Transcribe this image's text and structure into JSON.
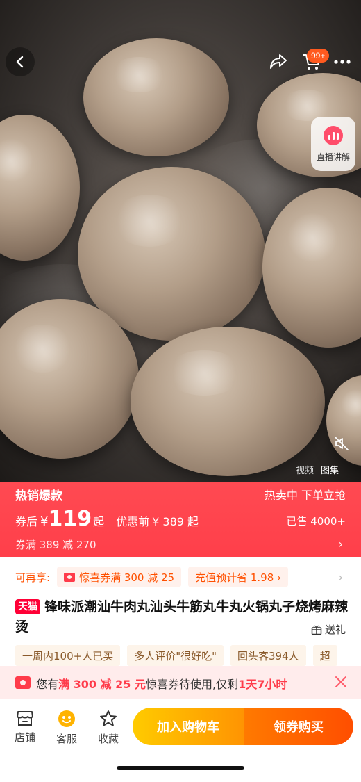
{
  "hero": {
    "cart_badge": "99+",
    "live_label": "直播讲解",
    "media_tabs": [
      "视频",
      "图集"
    ]
  },
  "banner": {
    "hot_label": "热销爆款",
    "selling_label": "热卖中 下单立抢",
    "after_coupon_label": "券后",
    "currency": "¥",
    "price": "119",
    "price_suffix": "起",
    "original_label": "优惠前",
    "original_price": "¥ 389 起",
    "sold": "已售 4000+",
    "coupon_info": "券满 389 减 270"
  },
  "benefits": {
    "label": "可再享:",
    "coupon_chip": "惊喜券满 300 减 25",
    "recharge_chip": "充值预计省 1.98 ›"
  },
  "product": {
    "badge": "天猫",
    "title": "锋味派潮汕牛肉丸汕头牛筋丸牛丸火锅丸子烧烤麻辣烫",
    "gift": "送礼",
    "tags": [
      "一周内100+人已买",
      "多人评价\"很好吃\"",
      "回头客394人",
      "超"
    ]
  },
  "notice": {
    "prefix": "您有",
    "highlight": "满 300 减 25 元",
    "middle": "惊喜券待使用,仅剩",
    "remain": "1天7小时"
  },
  "bottom_bar": {
    "shop_label": "店铺",
    "service_label": "客服",
    "fav_label": "收藏",
    "add_cart_label": "加入购物车",
    "buy_label": "领券购买"
  },
  "colors": {
    "banner_red": "#ff4a52",
    "tmall_red": "#ff0036",
    "accent_orange": "#ff5000",
    "cart_yellow": "#ffcb00",
    "buy_orange": "#ff4e00"
  },
  "icons": [
    "back-icon",
    "share-icon",
    "cart-icon",
    "more-icon",
    "live-icon",
    "mute-icon",
    "coupon-icon",
    "gift-icon",
    "close-icon",
    "shop-icon",
    "service-icon",
    "star-icon"
  ]
}
